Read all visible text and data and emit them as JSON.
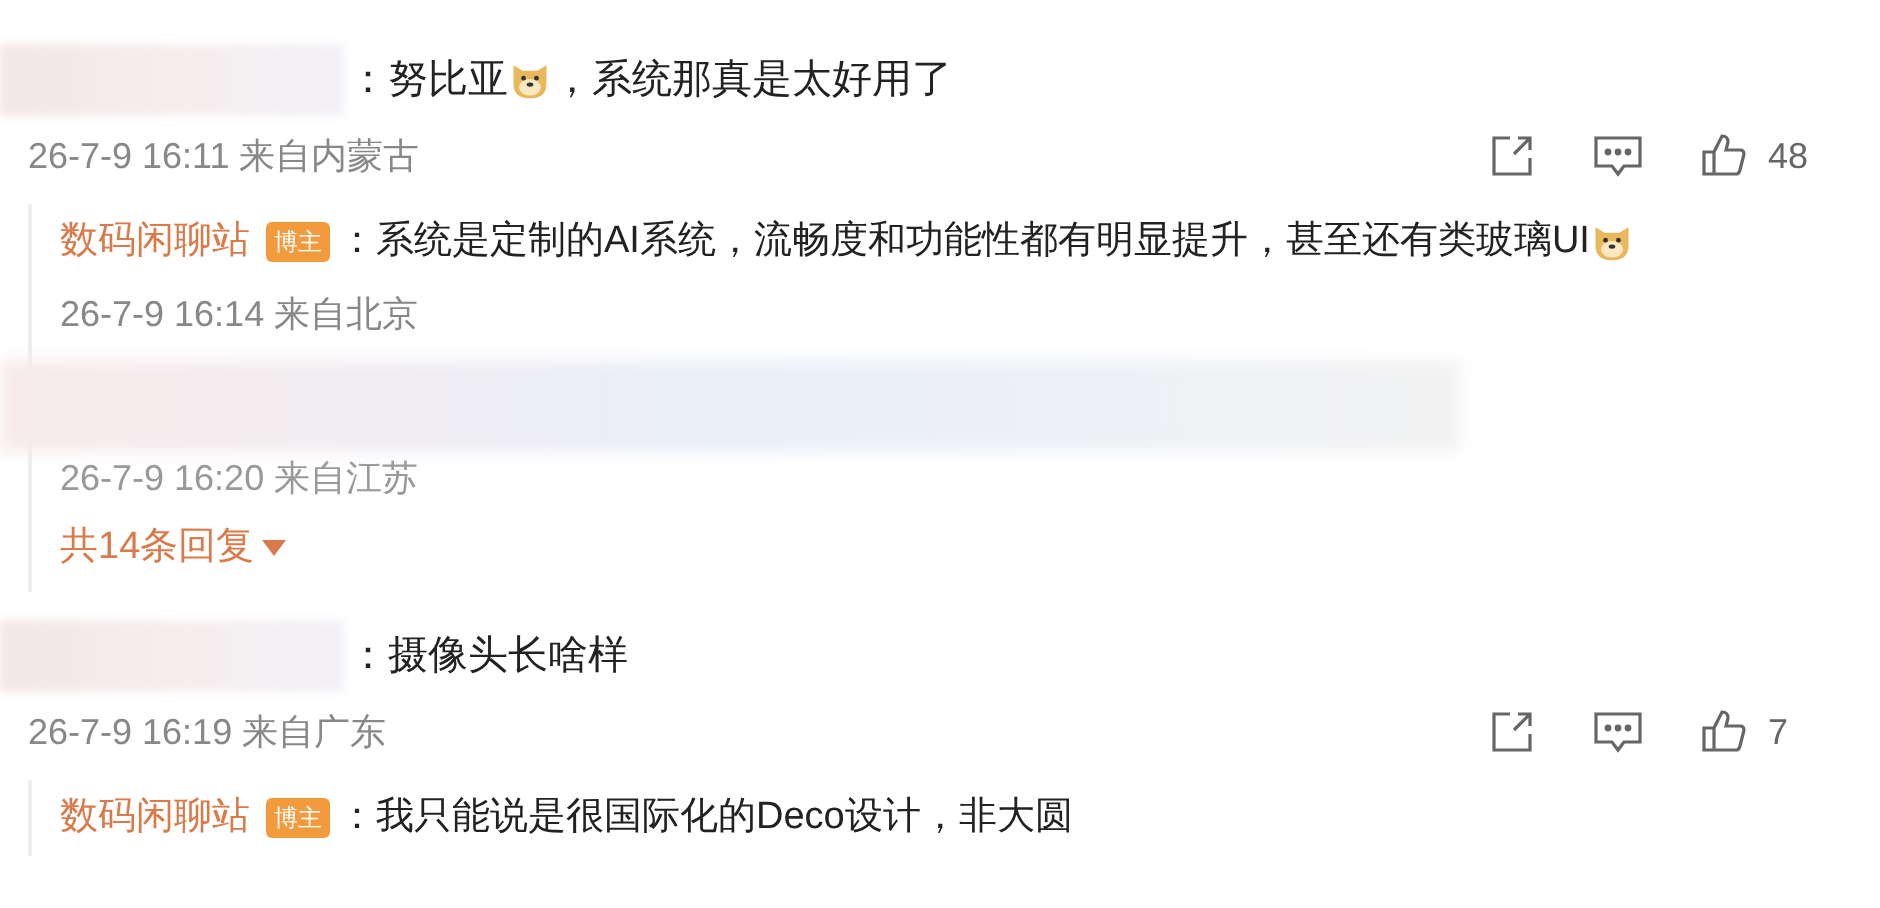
{
  "comments": [
    {
      "separator": "：",
      "content": [
        {
          "kind": "text",
          "text": "努比亚"
        },
        {
          "kind": "emoji"
        },
        {
          "kind": "text",
          "text": "，系统那真是太好用了"
        }
      ],
      "meta": "26-7-9 16:11 来自内蒙古",
      "likes": "48",
      "replies": [
        {
          "kind": "reply",
          "author": "数码闲聊站",
          "badge": "博主",
          "separator": "：",
          "content": [
            {
              "kind": "text",
              "text": "系统是定制的AI系统，流畅度和功能性都有明显提升，甚至还有类玻璃UI"
            },
            {
              "kind": "emoji"
            }
          ],
          "meta": "26-7-9 16:14 来自北京"
        },
        {
          "kind": "hidden",
          "meta": "26-7-9 16:20 来自江苏"
        }
      ],
      "more_replies": "共14条回复"
    },
    {
      "separator": "：",
      "content": [
        {
          "kind": "text",
          "text": "摄像头长啥样"
        }
      ],
      "meta": "26-7-9 16:19 来自广东",
      "likes": "7",
      "replies": [
        {
          "kind": "reply",
          "author": "数码闲聊站",
          "badge": "博主",
          "separator": "：",
          "content": [
            {
              "kind": "text",
              "text": "我只能说是很国际化的Deco设计，非大圆"
            }
          ]
        }
      ]
    }
  ]
}
